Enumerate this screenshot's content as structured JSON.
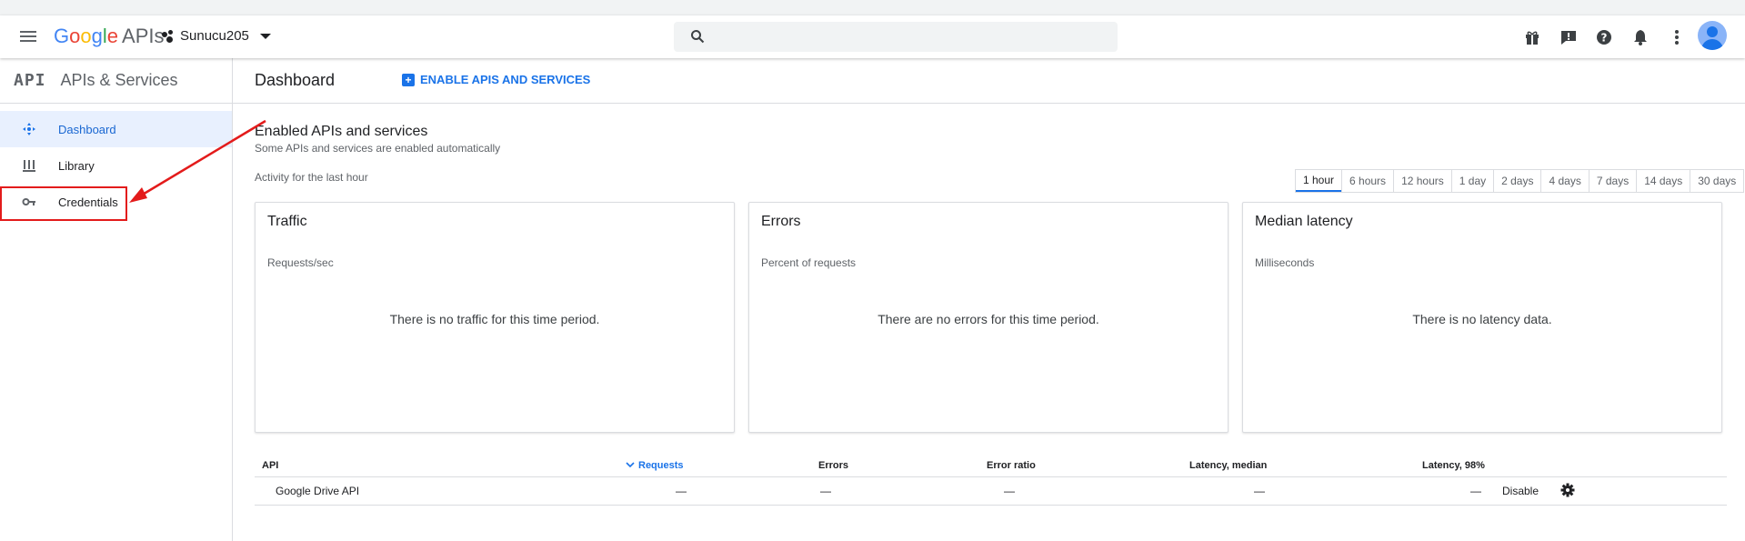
{
  "header": {
    "brand_g": "G",
    "brand_o1": "o",
    "brand_o2": "o",
    "brand_g2": "g",
    "brand_l": "l",
    "brand_e": "e",
    "brand_apis": "APIs",
    "project_name": "Sunucu205",
    "search_placeholder": ""
  },
  "sidebar": {
    "logo": "API",
    "title": "APIs & Services",
    "items": [
      {
        "label": "Dashboard",
        "icon": "dashboard-icon",
        "active": true
      },
      {
        "label": "Library",
        "icon": "library-icon",
        "active": false
      },
      {
        "label": "Credentials",
        "icon": "key-icon",
        "active": false
      }
    ]
  },
  "main": {
    "title": "Dashboard",
    "enable_button": "ENABLE APIS AND SERVICES",
    "section_title": "Enabled APIs and services",
    "section_subtitle": "Some APIs and services are enabled automatically",
    "activity_label": "Activity for the last hour",
    "ranges": [
      "1 hour",
      "6 hours",
      "12 hours",
      "1 day",
      "2 days",
      "4 days",
      "7 days",
      "14 days",
      "30 days"
    ],
    "cards": [
      {
        "title": "Traffic",
        "subtitle": "Requests/sec",
        "message": "There is no traffic for this time period."
      },
      {
        "title": "Errors",
        "subtitle": "Percent of requests",
        "message": "There are no errors for this time period."
      },
      {
        "title": "Median latency",
        "subtitle": "Milliseconds",
        "message": "There is no latency data."
      }
    ],
    "table": {
      "headers": [
        "API",
        "Requests",
        "Errors",
        "Error ratio",
        "Latency, median",
        "Latency, 98%"
      ],
      "rows": [
        {
          "api": "Google Drive API",
          "requests": "—",
          "errors": "—",
          "error_ratio": "—",
          "latency_median": "—",
          "latency_98": "—",
          "action": "Disable"
        }
      ]
    }
  },
  "colors": {
    "accent": "#1a73e8",
    "annotation": "#e31b1b",
    "active_bg": "#e8f0fe"
  }
}
